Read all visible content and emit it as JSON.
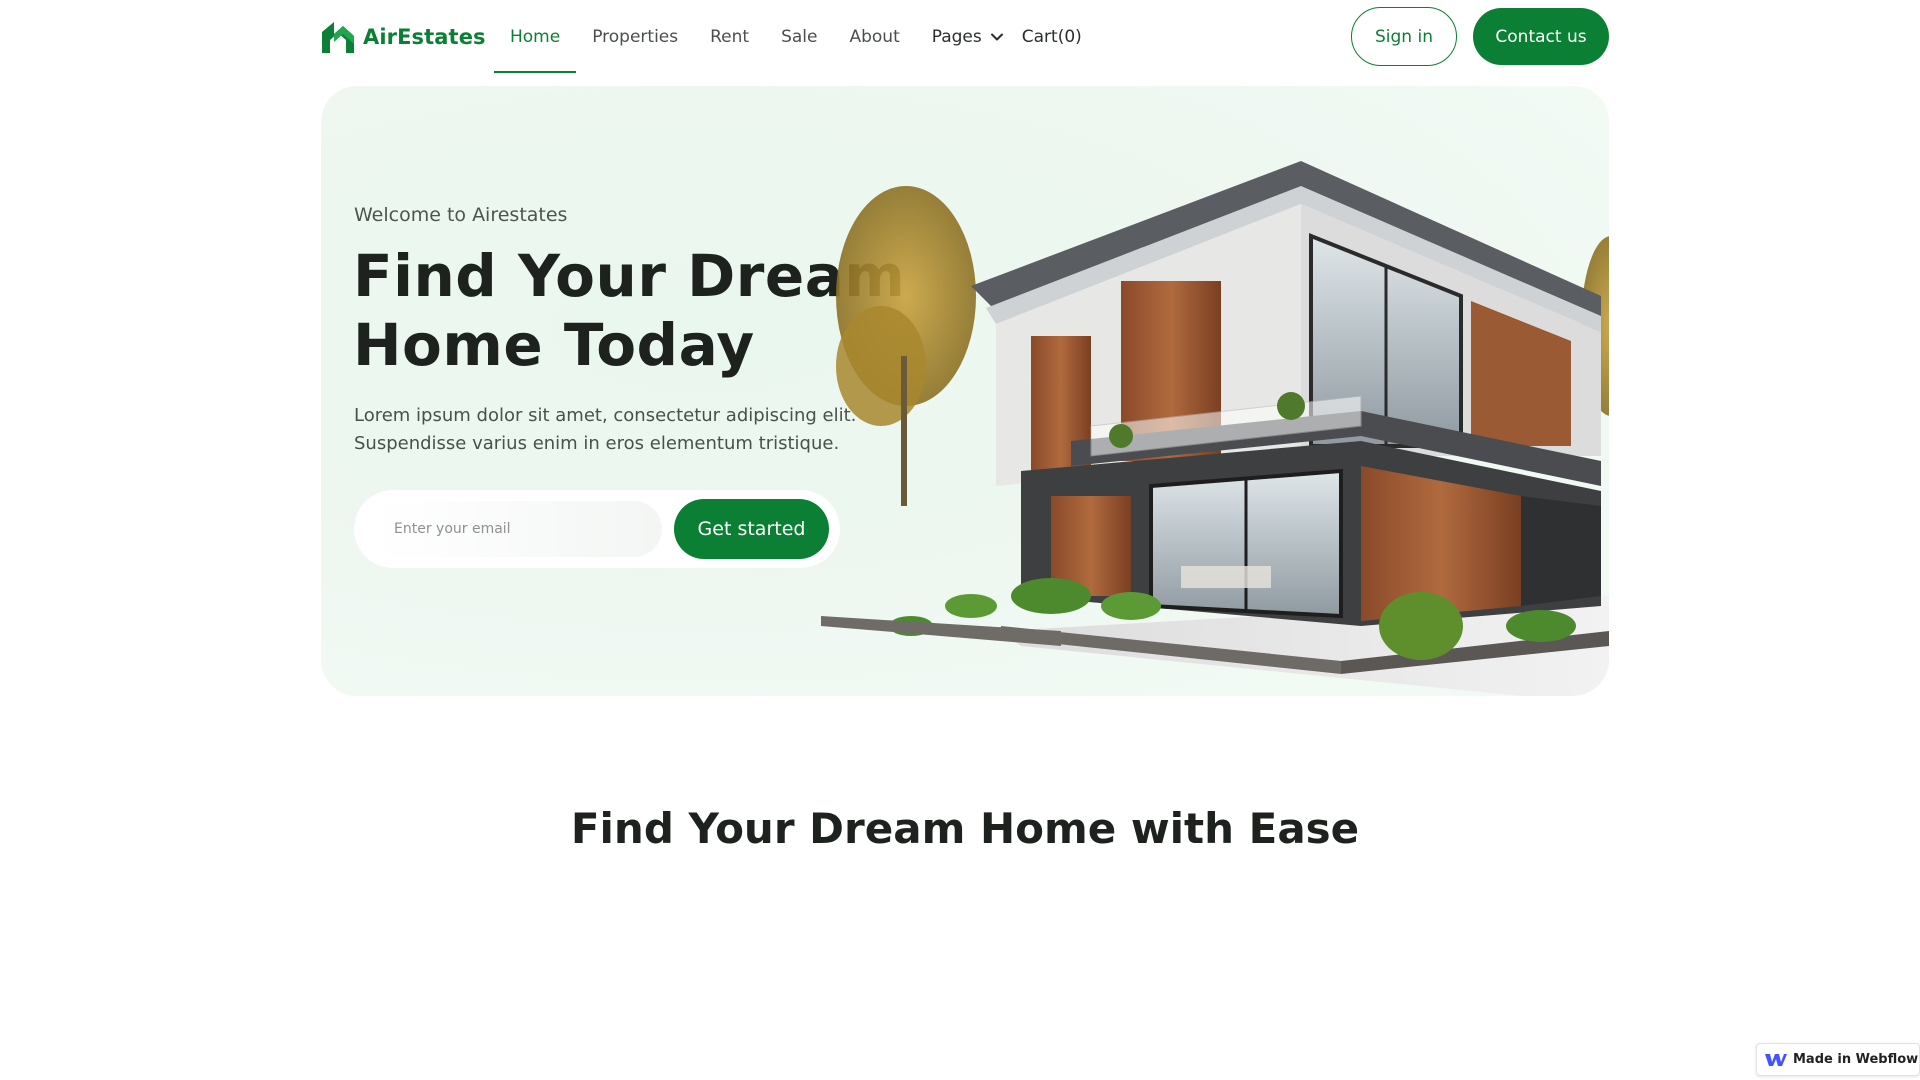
{
  "brand": {
    "name": "AirEstates",
    "color": "#0b7f33"
  },
  "nav": {
    "items": [
      {
        "label": "Home",
        "active": true
      },
      {
        "label": "Properties",
        "active": false
      },
      {
        "label": "Rent",
        "active": false
      },
      {
        "label": "Sale",
        "active": false
      },
      {
        "label": "About",
        "active": false
      }
    ],
    "pages_label": "Pages",
    "cart_label": "Cart(0)",
    "signin_label": "Sign in",
    "contact_label": "Contact us"
  },
  "hero": {
    "eyebrow": "Welcome to Airestates",
    "title": "Find Your Dream Home Today",
    "description": "Lorem ipsum dolor sit amet, consectetur adipiscing elit. Suspendisse varius enim in eros elementum tristique.",
    "email_placeholder": "Enter your email",
    "cta_label": "Get started",
    "image": "modern-house-illustration",
    "background": "#edf7f0"
  },
  "section": {
    "title": "Find Your Dream Home with Ease"
  },
  "badge": {
    "label": "Made in Webflow",
    "icon": "webflow-icon"
  }
}
